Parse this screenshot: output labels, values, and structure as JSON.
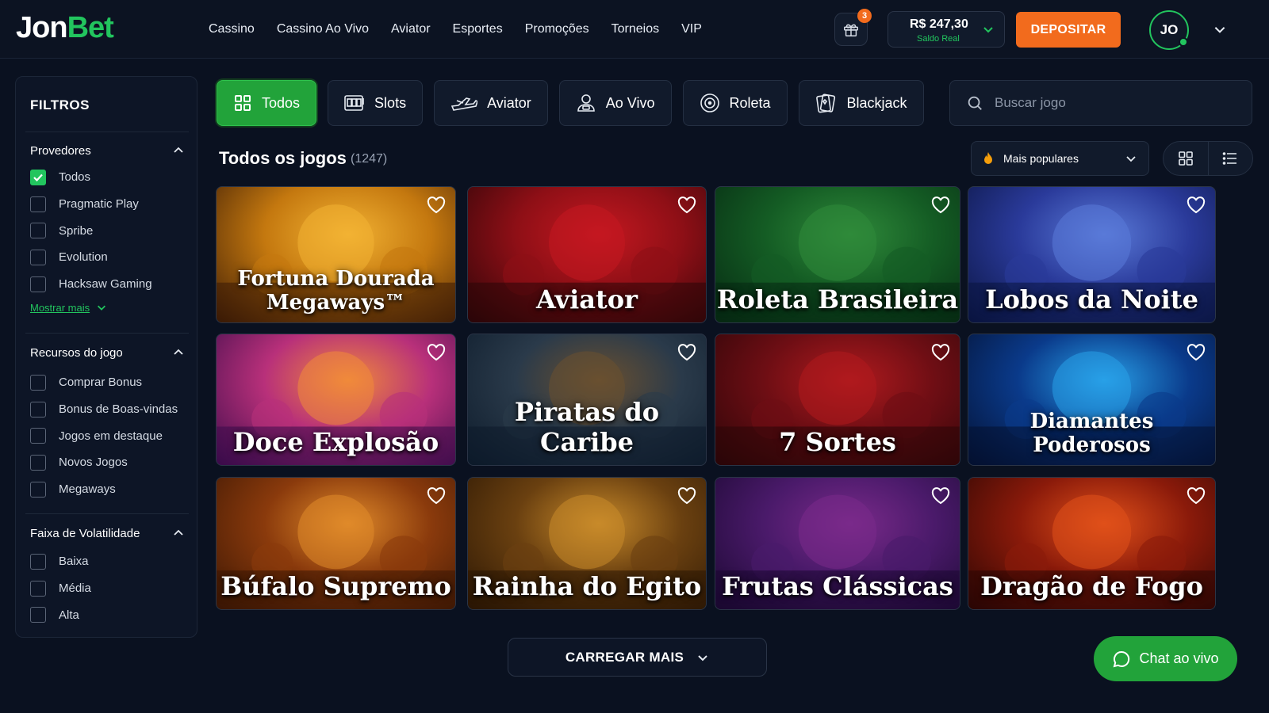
{
  "brand": {
    "part1": "Jon",
    "part2": "Bet"
  },
  "nav": [
    "Cassino",
    "Cassino Ao Vivo",
    "Aviator",
    "Esportes",
    "Promoções",
    "Torneios",
    "VIP"
  ],
  "header": {
    "gift_badge": "3",
    "balance_amount": "R$ 247,30",
    "balance_label": "Saldo Real",
    "deposit_label": "DEPOSITAR",
    "avatar_initials": "JO"
  },
  "sidebar": {
    "title": "FILTROS",
    "providers": {
      "title": "Provedores",
      "options": [
        {
          "label": "Todos",
          "checked": true
        },
        {
          "label": "Pragmatic Play",
          "checked": false
        },
        {
          "label": "Spribe",
          "checked": false
        },
        {
          "label": "Evolution",
          "checked": false
        },
        {
          "label": "Hacksaw Gaming",
          "checked": false
        }
      ],
      "show_more": "Mostrar mais"
    },
    "features": {
      "title": "Recursos do jogo",
      "options": [
        "Comprar Bonus",
        "Bonus de Boas-vindas",
        "Jogos em destaque",
        "Novos Jogos",
        "Megaways"
      ]
    },
    "volatility": {
      "title": "Faixa de Volatilidade",
      "options": [
        "Baixa",
        "Média",
        "Alta"
      ]
    }
  },
  "tabs": [
    {
      "label": "Todos",
      "active": true
    },
    {
      "label": "Slots",
      "active": false
    },
    {
      "label": "Aviator",
      "active": false
    },
    {
      "label": "Ao Vivo",
      "active": false
    },
    {
      "label": "Roleta",
      "active": false
    },
    {
      "label": "Blackjack",
      "active": false
    }
  ],
  "search": {
    "placeholder": "Buscar jogo"
  },
  "games_section": {
    "title": "Todos os jogos",
    "count": "(1247)",
    "sort_label": "Mais populares"
  },
  "games": [
    {
      "title": "Fortuna Dourada Megaways™",
      "palette": [
        "#3a1a05",
        "#c4780f",
        "#f2b233"
      ]
    },
    {
      "title": "Aviator",
      "palette": [
        "#2a0508",
        "#8e0f16",
        "#c41820"
      ]
    },
    {
      "title": "Roleta Brasileira",
      "palette": [
        "#062812",
        "#145c24",
        "#2f8a3a"
      ]
    },
    {
      "title": "Lobos da Noite",
      "palette": [
        "#0a1440",
        "#2a3a9a",
        "#5a7ad8"
      ]
    },
    {
      "title": "Doce Explosão",
      "palette": [
        "#3a0b4a",
        "#b8307a",
        "#f08a3a"
      ]
    },
    {
      "title": "Piratas do Caribe",
      "palette": [
        "#0c1a2a",
        "#2a3a4a",
        "#6a5030"
      ]
    },
    {
      "title": "7 Sortes",
      "palette": [
        "#2a0508",
        "#6e0e14",
        "#b01a1e"
      ]
    },
    {
      "title": "Diamantes Poderosos",
      "palette": [
        "#041030",
        "#0a3a8a",
        "#28a0e8"
      ]
    },
    {
      "title": "Búfalo Supremo",
      "palette": [
        "#3a1604",
        "#8a3a0c",
        "#e08a2a"
      ]
    },
    {
      "title": "Rainha do Egito",
      "palette": [
        "#2a1604",
        "#6a4010",
        "#c88a2a"
      ]
    },
    {
      "title": "Frutas Clássicas",
      "palette": [
        "#1a0830",
        "#4a1a6a",
        "#7a2a8a"
      ]
    },
    {
      "title": "Dragão de Fogo",
      "palette": [
        "#2a0604",
        "#8a1a0a",
        "#e0501a"
      ]
    }
  ],
  "load_more": "CARREGAR MAIS",
  "chat": "Chat ao vivo"
}
